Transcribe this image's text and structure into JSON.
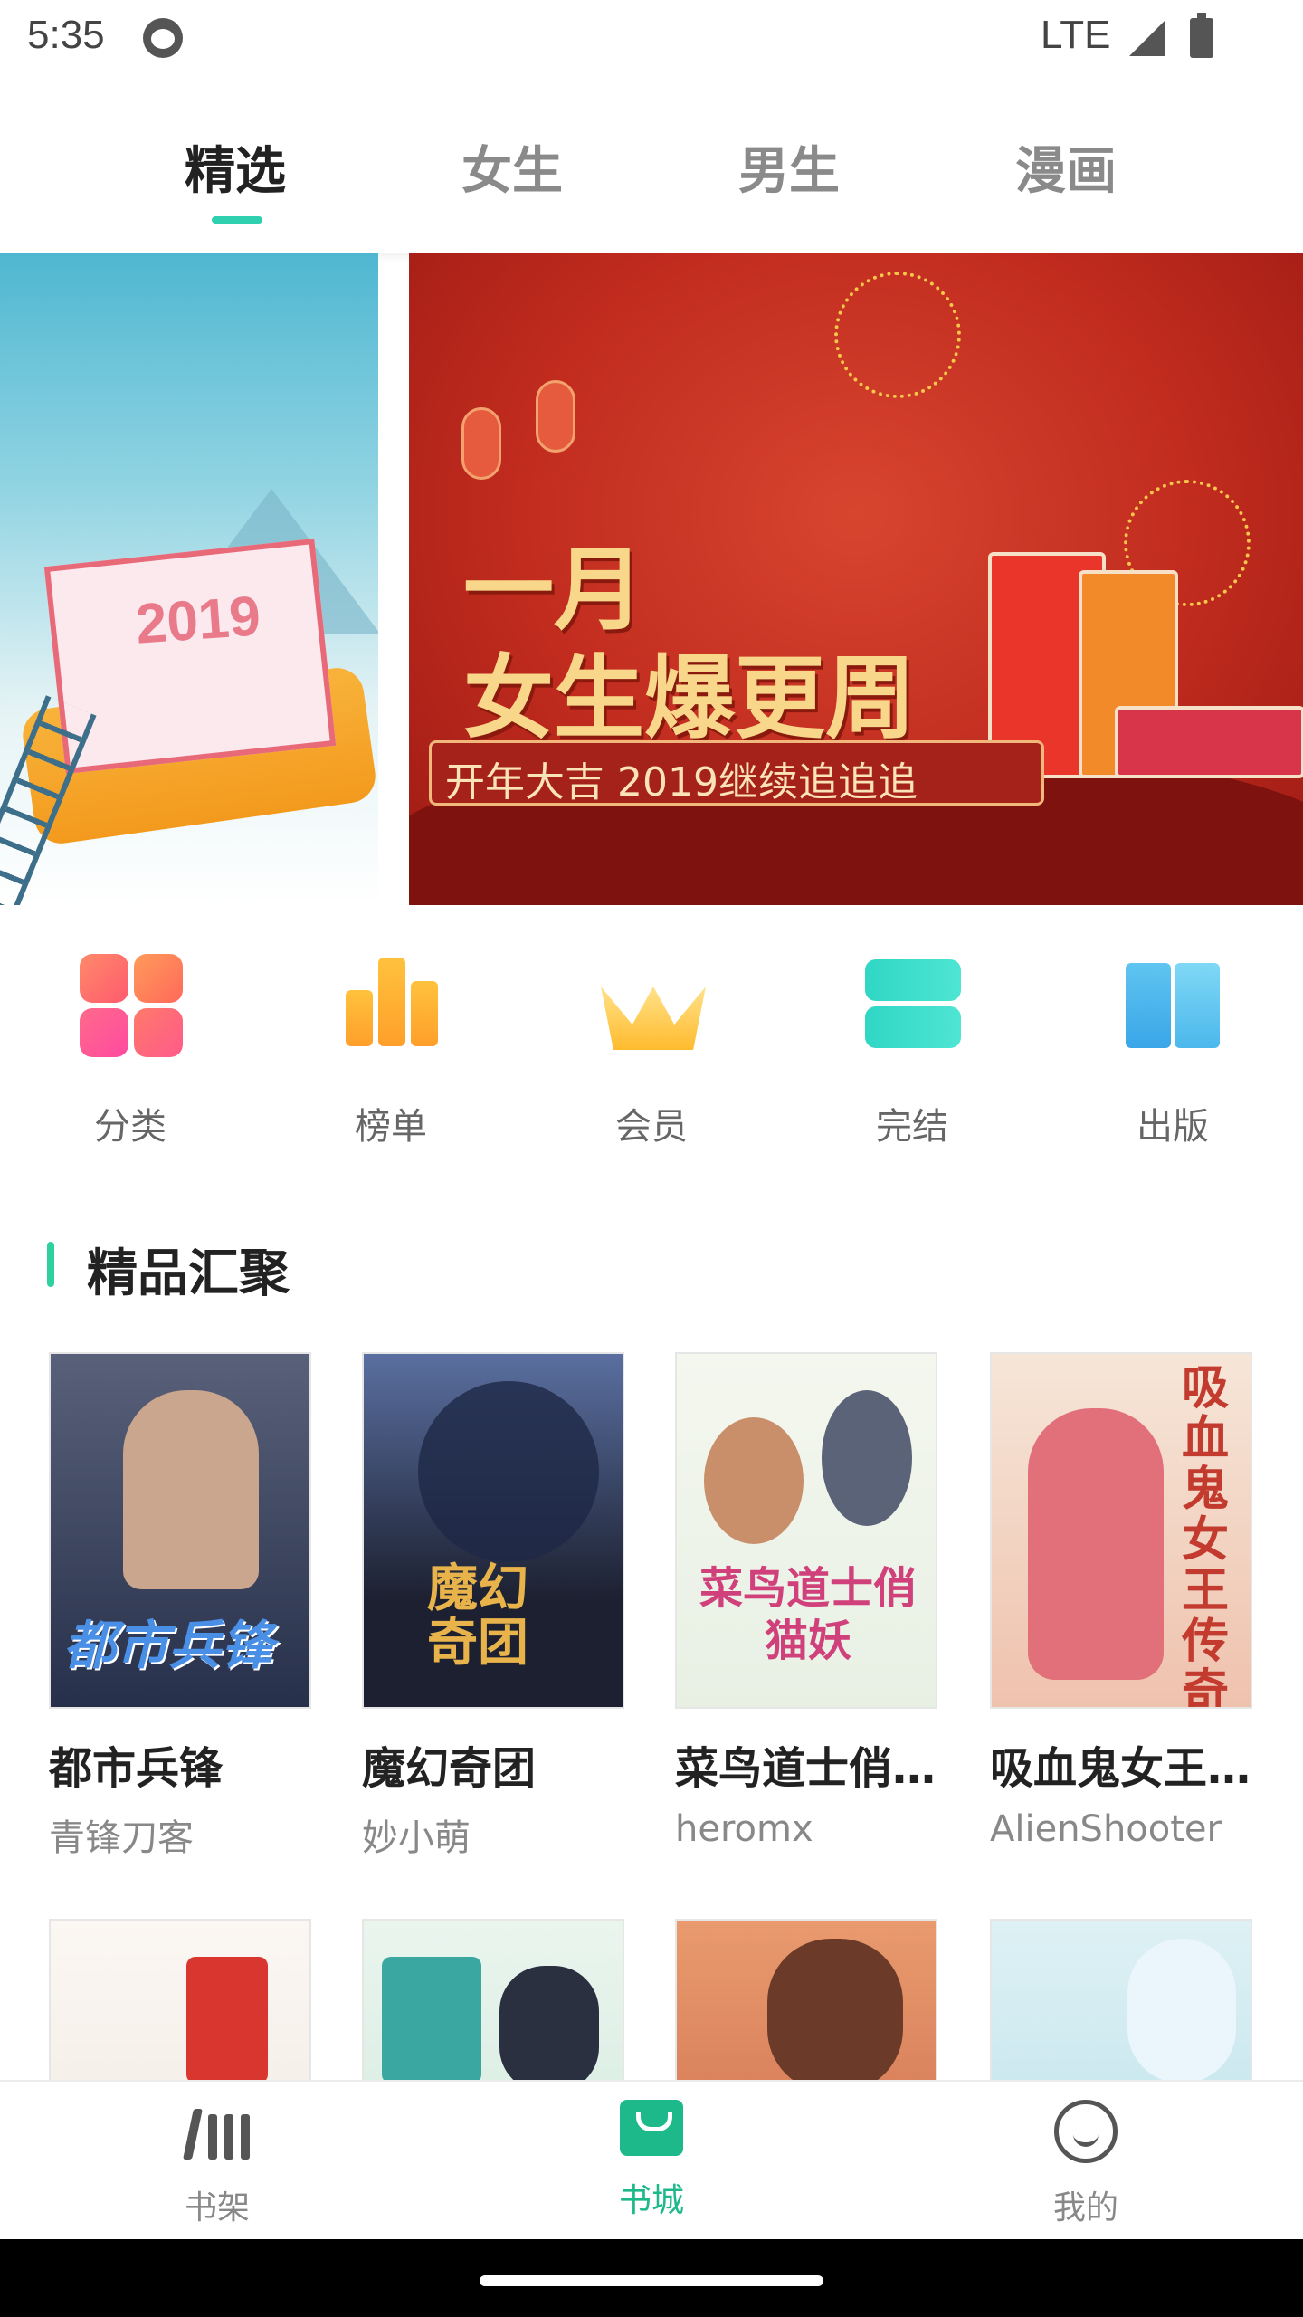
{
  "status_bar": {
    "time": "5:35",
    "network": "LTE"
  },
  "top_tabs": [
    {
      "label": "精选",
      "active": true
    },
    {
      "label": "女生",
      "active": false
    },
    {
      "label": "男生",
      "active": false
    },
    {
      "label": "漫画",
      "active": false
    }
  ],
  "banner": {
    "left_slide": {
      "year": "2019"
    },
    "main_slide": {
      "headline_line1": "一月",
      "headline_line2": "女生爆更周",
      "ribbon": "开年大吉 2019继续追追追"
    }
  },
  "categories": [
    {
      "label": "分类",
      "icon": "grid-icon"
    },
    {
      "label": "榜单",
      "icon": "ranking-icon"
    },
    {
      "label": "会员",
      "icon": "crown-icon"
    },
    {
      "label": "完结",
      "icon": "finished-icon"
    },
    {
      "label": "出版",
      "icon": "book-icon"
    }
  ],
  "section": {
    "title": "精品汇聚"
  },
  "books": [
    {
      "title": "都市兵锋",
      "author": "青锋刀客",
      "cover_text": "都市兵锋",
      "cover_color": "#2a3550"
    },
    {
      "title": "魔幻奇团",
      "author": "妙小萌",
      "cover_text": "魔幻奇团",
      "cover_color": "#1b2030"
    },
    {
      "title": "菜鸟道士俏…",
      "author": "heromx",
      "cover_text": "菜鸟道士俏猫妖",
      "cover_color": "#eef3ea"
    },
    {
      "title": "吸血鬼女王…",
      "author": "AlienShooter",
      "cover_text": "吸血鬼女王传奇",
      "cover_color": "#f3d6c8"
    }
  ],
  "books_row2": [
    {
      "cover_color": "#f7f2ee"
    },
    {
      "cover_color": "#e9f4ef"
    },
    {
      "cover_color": "#e7a27a"
    },
    {
      "cover_color": "#d7eef3"
    }
  ],
  "bottom_nav": [
    {
      "label": "书架",
      "icon": "bookshelf-icon",
      "active": false
    },
    {
      "label": "书城",
      "icon": "bookstore-icon",
      "active": true
    },
    {
      "label": "我的",
      "icon": "profile-icon",
      "active": false
    }
  ],
  "colors": {
    "accent": "#1db98a",
    "tab_indicator": "#2ed0b0"
  }
}
